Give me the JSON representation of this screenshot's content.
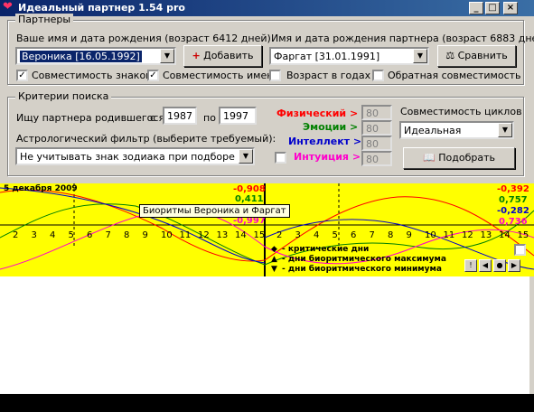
{
  "window": {
    "title": "Идеальный партнер 1.54 pro"
  },
  "partners": {
    "group_label": "Партнеры",
    "your_label": "Ваше имя и дата рождения (возраст 6412 дней)",
    "partner_label": "Имя и дата рождения партнера (возраст 6883 дней)",
    "your_value": "Вероника [16.05.1992]",
    "partner_value": "Фаргат [31.01.1991]",
    "add_button": "Добавить",
    "compare_button": "Сравнить",
    "check_signs": "Совместимость знаков",
    "check_names": "Совместимость имен",
    "check_age": "Возраст в годах",
    "check_reverse": "Обратная совместимость"
  },
  "criteria": {
    "group_label": "Критерии поиска",
    "search_label": "Ищу партнера родившегося",
    "from_label": "с",
    "from_value": "1987",
    "to_label": "по",
    "to_value": "1997",
    "astro_label": "Астрологический фильтр (выберите требуемый):",
    "astro_value": "Не учитывать знак зодиака при подборе",
    "physical": "Физический >",
    "emotions": "Эмоции >",
    "intellect": "Интеллект >",
    "intuition": "Интуиция >",
    "physical_val": "80",
    "emotions_val": "80",
    "intellect_val": "80",
    "intuition_val": "80",
    "cycles_label": "Совместимость циклов",
    "cycles_value": "Идеальная",
    "pick_button": "Подобрать"
  },
  "chart": {
    "date": "5 декабря 2009",
    "left_values": [
      "-0,908",
      "0,411",
      "-0,997"
    ],
    "right_values": [
      "-0,392",
      "0,757",
      "-0,282",
      "0,736"
    ],
    "ticks_left": [
      "2",
      "3",
      "4",
      "5",
      "6",
      "7",
      "8",
      "9",
      "10",
      "11",
      "12",
      "13",
      "14",
      "15"
    ],
    "ticks_right": [
      "2",
      "3",
      "4",
      "5",
      "6",
      "7",
      "8",
      "9",
      "10",
      "11",
      "12",
      "13",
      "14",
      "15"
    ],
    "tooltip": "Биоритмы Вероника и Фаргат",
    "legend": [
      "- критические дни",
      "- дни биоритмического максимума",
      "- дни биоритмического минимума"
    ],
    "colors": {
      "physical": "#ff0000",
      "emotions": "#008000",
      "intellect": "#0000cc",
      "intuition": "#ff00cc"
    }
  }
}
